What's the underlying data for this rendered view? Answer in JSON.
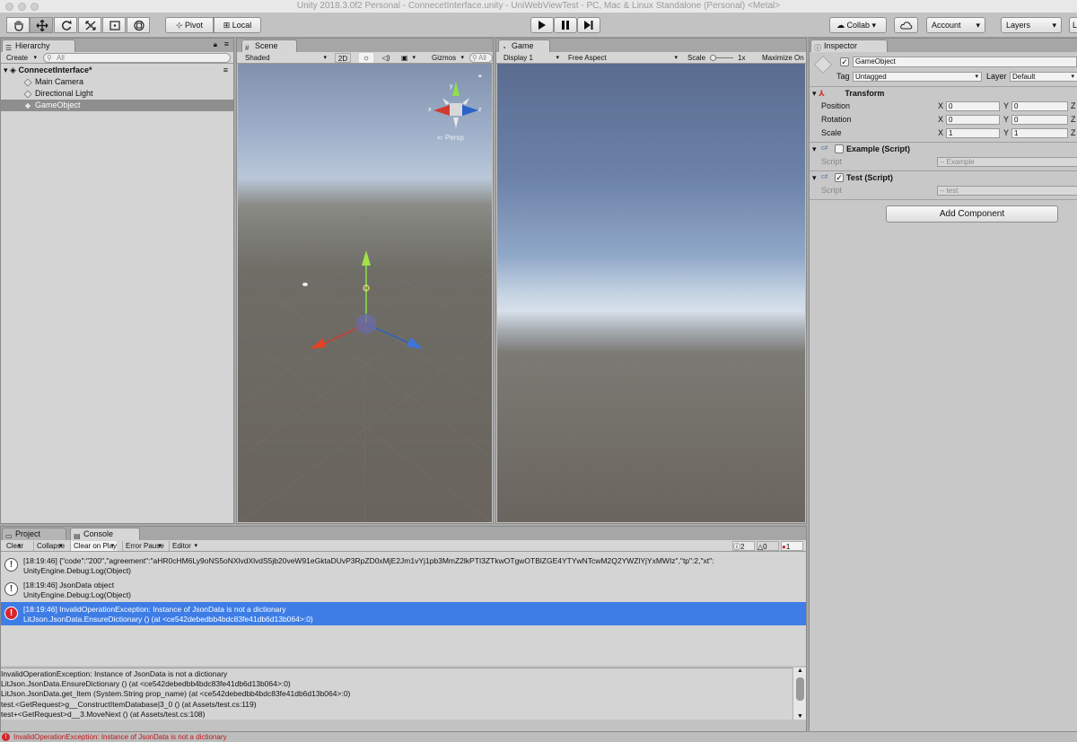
{
  "window": {
    "title": "Unity 2018.3.0f2 Personal - ConnecetInterface.unity - UniWebViewTest - PC, Mac & Linux Standalone (Personal) <Metal>"
  },
  "toolbar": {
    "tools": [
      "hand-tool",
      "move-tool",
      "rotate-tool",
      "scale-tool",
      "rect-tool",
      "transform-tool"
    ],
    "pivot_label": "Pivot",
    "local_label": "Local",
    "collab_label": "Collab",
    "account_label": "Account",
    "layers_label": "Layers",
    "layout_label": "L"
  },
  "hierarchy": {
    "tab_label": "Hierarchy",
    "create_label": "Create",
    "search_placeholder": "All",
    "scene_name": "ConnecetInterface*",
    "items": [
      {
        "label": "Main Camera"
      },
      {
        "label": "Directional Light"
      },
      {
        "label": "GameObject"
      }
    ]
  },
  "scene": {
    "tab_label": "Scene",
    "shading_mode": "Shaded",
    "mode_2d": "2D",
    "gizmos_label": "Gizmos",
    "search_placeholder": "All",
    "persp_label": "Persp",
    "axis_labels": {
      "y": "y",
      "x": "x",
      "z": "z"
    }
  },
  "game": {
    "tab_label": "Game",
    "display": "Display 1",
    "aspect": "Free Aspect",
    "scale_label": "Scale",
    "scale_value": "1x",
    "maximize_label": "Maximize On"
  },
  "inspector": {
    "tab_label": "Inspector",
    "object_name": "GameObject",
    "tag_label": "Tag",
    "tag_value": "Untagged",
    "layer_label": "Layer",
    "layer_value": "Default",
    "transform": {
      "title": "Transform",
      "rows": [
        {
          "label": "Position",
          "x": "0",
          "y": "0"
        },
        {
          "label": "Rotation",
          "x": "0",
          "y": "0"
        },
        {
          "label": "Scale",
          "x": "1",
          "y": "1"
        }
      ],
      "x_label": "X",
      "y_label": "Y",
      "z_label": "Z"
    },
    "components": [
      {
        "title": "Example (Script)",
        "script_label": "Script",
        "script_value": "Example",
        "enabled": false
      },
      {
        "title": "Test (Script)",
        "script_label": "Script",
        "script_value": "test",
        "enabled": true
      }
    ],
    "add_component_label": "Add Component"
  },
  "bottom_tabs": {
    "project_label": "Project",
    "console_label": "Console"
  },
  "console": {
    "buttons": {
      "clear": "Clear",
      "collapse": "Collapse",
      "clear_on_play": "Clear on Play",
      "error_pause": "Error Pause",
      "editor": "Editor"
    },
    "counts": {
      "logs": "2",
      "warnings": "0",
      "errors": "1"
    },
    "entries": [
      {
        "type": "log",
        "line1": "[18:19:46] {\"code\":\"200\",\"agreement\":\"aHR0cHM6Ly9oNS5oNXlvdXlvdS5jb20veW91eGktaDUvP3RpZD0xMjE2Jm1vYj1pb3MmZ2lkPTI3ZTkwOTgwOTBlZGE4YTYwNTcwM2Q2YWZlYjYxMWIz\",\"tp\":2,\"xt\":",
        "line2": "UnityEngine.Debug:Log(Object)"
      },
      {
        "type": "log",
        "line1": "[18:19:46] JsonData object",
        "line2": "UnityEngine.Debug:Log(Object)"
      },
      {
        "type": "error",
        "line1": "[18:19:46] InvalidOperationException: Instance of JsonData is not a dictionary",
        "line2": "LitJson.JsonData.EnsureDictionary () (at <ce542debedbb4bdc83fe41db6d13b064>:0)"
      }
    ],
    "detail_lines": [
      "InvalidOperationException: Instance of JsonData is not a dictionary",
      "LitJson.JsonData.EnsureDictionary () (at <ce542debedbb4bdc83fe41db6d13b064>:0)",
      "LitJson.JsonData.get_Item (System.String prop_name) (at <ce542debedbb4bdc83fe41db6d13b064>:0)",
      "test.<GetRequest>g__ConstructItemDatabase|3_0 () (at Assets/test.cs:119)",
      "test+<GetRequest>d__3.MoveNext () (at Assets/test.cs:108)"
    ]
  },
  "status_bar": {
    "message": "InvalidOperationException: Instance of JsonData is not a dictionary"
  },
  "colors": {
    "selection": "#3e7de6",
    "error": "#d8262b",
    "panel": "#c2c2c2"
  }
}
